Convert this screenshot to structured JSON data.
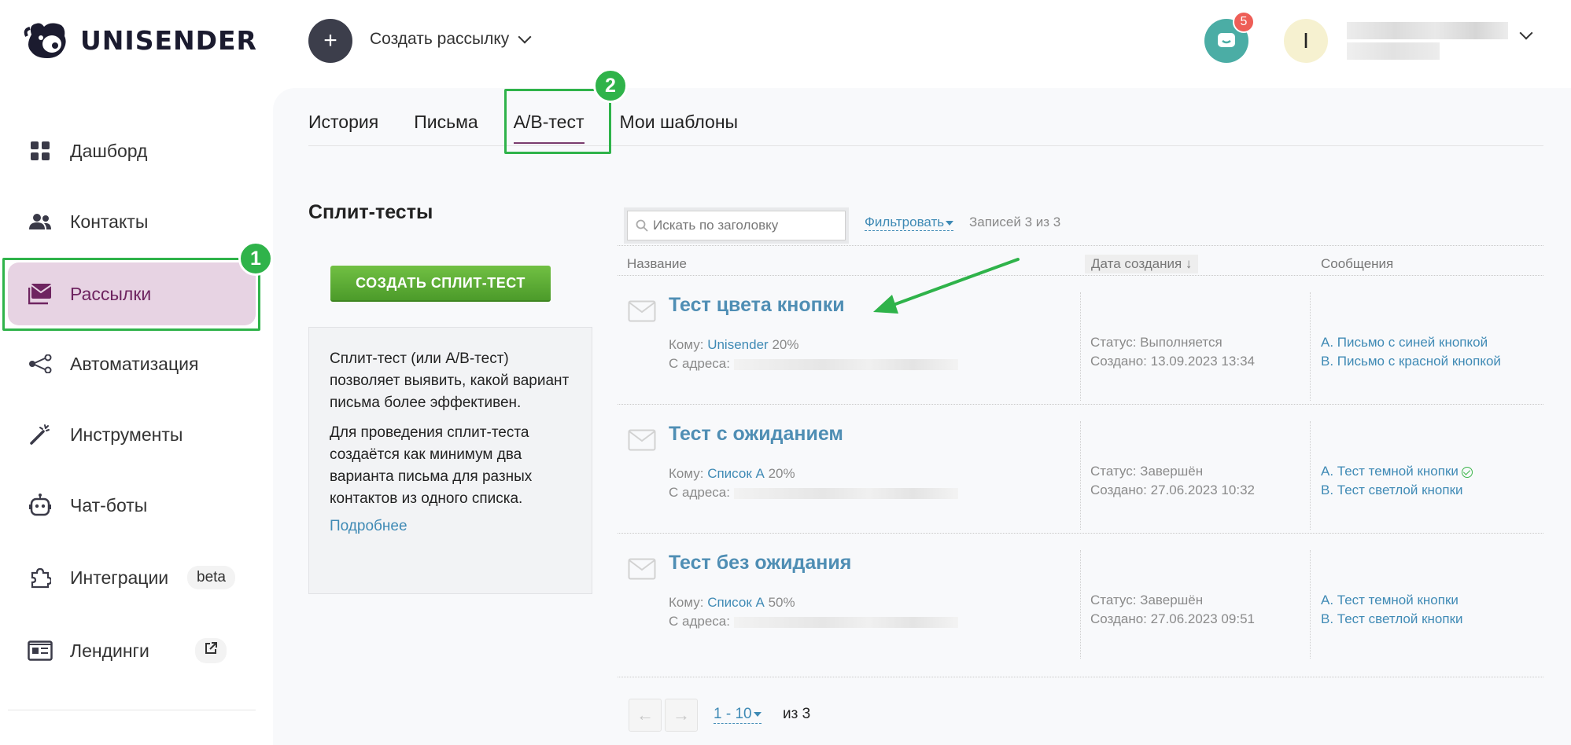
{
  "header": {
    "logo_text": "UNISENDER",
    "create_button": "+",
    "create_label": "Создать рассылку",
    "notification_count": "5",
    "user_initial": "I"
  },
  "sidebar": {
    "items": [
      {
        "label": "Дашборд",
        "icon": "dashboard-icon"
      },
      {
        "label": "Контакты",
        "icon": "contacts-icon"
      },
      {
        "label": "Рассылки",
        "icon": "mail-stack-icon",
        "active": true
      },
      {
        "label": "Автоматизация",
        "icon": "automation-icon"
      },
      {
        "label": "Инструменты",
        "icon": "magic-wand-icon"
      },
      {
        "label": "Чат-боты",
        "icon": "robot-icon"
      },
      {
        "label": "Интеграции",
        "icon": "puzzle-icon",
        "badge": "beta"
      },
      {
        "label": "Лендинги",
        "icon": "landing-icon",
        "badge_icon": "external-link-icon"
      }
    ]
  },
  "annotations": {
    "one": "1",
    "two": "2"
  },
  "tabs": [
    {
      "label": "История"
    },
    {
      "label": "Письма"
    },
    {
      "label": "A/B-тест",
      "active": true
    },
    {
      "label": "Мои шаблоны"
    }
  ],
  "left_panel": {
    "title": "Сплит-тесты",
    "create_button": "СОЗДАТЬ СПЛИТ-ТЕСТ",
    "info_p1": "Сплит-тест (или A/B-тест) позволяет выявить, какой вариант письма более эффективен.",
    "info_p2": "Для проведения сплит-теста создаётся как минимум два варианта письма для разных контактов из одного списка.",
    "more_link": "Подробнее"
  },
  "toolbar": {
    "search_placeholder": "Искать по заголовку",
    "filter_label": "Фильтровать",
    "records_label": "Записей 3 из 3"
  },
  "table": {
    "headers": {
      "name": "Название",
      "date": "Дата создания ↓",
      "messages": "Сообщения"
    },
    "rows": [
      {
        "title": "Тест цвета кнопки",
        "to_label": "Кому:",
        "to_list": "Unisender",
        "to_pct": "20%",
        "from_label": "С адреса:",
        "status": "Статус: Выполняется",
        "created": "Создано: 13.09.2023 13:34",
        "msg_a": "A. Письмо с синей кнопкой",
        "msg_b": "B. Письмо с красной кнопкой"
      },
      {
        "title": "Тест с ожиданием",
        "to_label": "Кому:",
        "to_list": "Список А",
        "to_pct": "20%",
        "from_label": "С адреса:",
        "status": "Статус: Завершён",
        "created": "Создано: 27.06.2023 10:32",
        "msg_a": "A. Тест темной кнопки",
        "msg_b": "B. Тест светлой кнопки"
      },
      {
        "title": "Тест без ожидания",
        "to_label": "Кому:",
        "to_list": "Список А",
        "to_pct": "50%",
        "from_label": "С адреса:",
        "status": "Статус: Завершён",
        "created": "Создано: 27.06.2023 09:51",
        "msg_a": "A. Тест темной кнопки",
        "msg_b": "B. Тест светлой кнопки"
      }
    ]
  },
  "pagination": {
    "prev": "←",
    "next": "→",
    "range": "1 - 10",
    "of": "из 3"
  },
  "colors": {
    "accent": "#2fb34a",
    "link": "#3f8ab5",
    "active_nav": "#e7d3e3"
  }
}
